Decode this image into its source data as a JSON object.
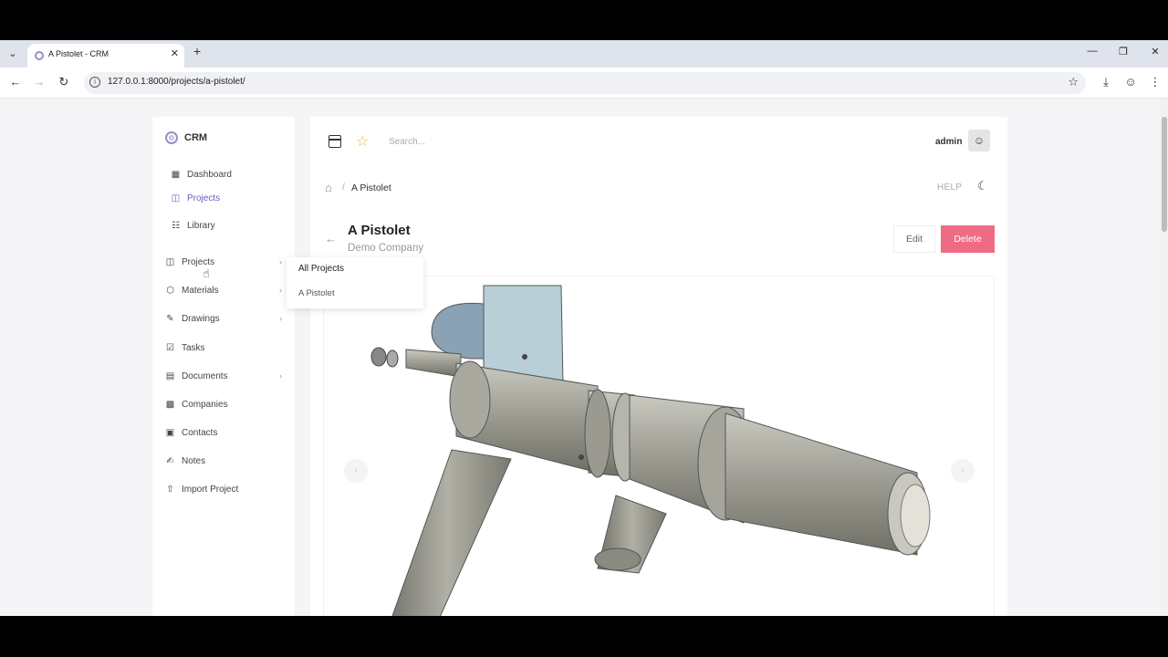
{
  "browser": {
    "tab_title": "A Pistolet - CRM",
    "url": "127.0.0.1:8000/projects/a-pistolet/"
  },
  "sidebar": {
    "brand": "CRM",
    "top_items": [
      {
        "label": "Dashboard",
        "icon": "dashboard-icon"
      },
      {
        "label": "Projects",
        "icon": "projects-icon",
        "active": true
      },
      {
        "label": "Library",
        "icon": "library-icon"
      }
    ],
    "items": [
      {
        "label": "Projects",
        "icon": "projects-icon",
        "has_submenu": true
      },
      {
        "label": "Materials",
        "icon": "materials-icon",
        "has_submenu": true
      },
      {
        "label": "Drawings",
        "icon": "drawings-icon",
        "has_submenu": true
      },
      {
        "label": "Tasks",
        "icon": "tasks-icon",
        "has_submenu": false
      },
      {
        "label": "Documents",
        "icon": "documents-icon",
        "has_submenu": true
      },
      {
        "label": "Companies",
        "icon": "companies-icon",
        "has_submenu": false
      },
      {
        "label": "Contacts",
        "icon": "contacts-icon",
        "has_submenu": false
      },
      {
        "label": "Notes",
        "icon": "notes-icon",
        "has_submenu": false
      },
      {
        "label": "Import Project",
        "icon": "upload-icon",
        "has_submenu": false
      }
    ],
    "active_color": "#6a5bbf"
  },
  "dropdown": {
    "items": [
      "All Projects",
      "A Pistolet"
    ]
  },
  "header": {
    "search_placeholder": "Search...",
    "user": "admin"
  },
  "breadcrumb": {
    "current": "A Pistolet",
    "help": "HELP"
  },
  "project": {
    "title": "A Pistolet",
    "company": "Demo Company",
    "edit_label": "Edit",
    "delete_label": "Delete",
    "delete_color": "#ef6b83"
  },
  "carousel": {
    "prev_icon": "chevron-left-icon",
    "next_icon": "chevron-right-icon"
  }
}
